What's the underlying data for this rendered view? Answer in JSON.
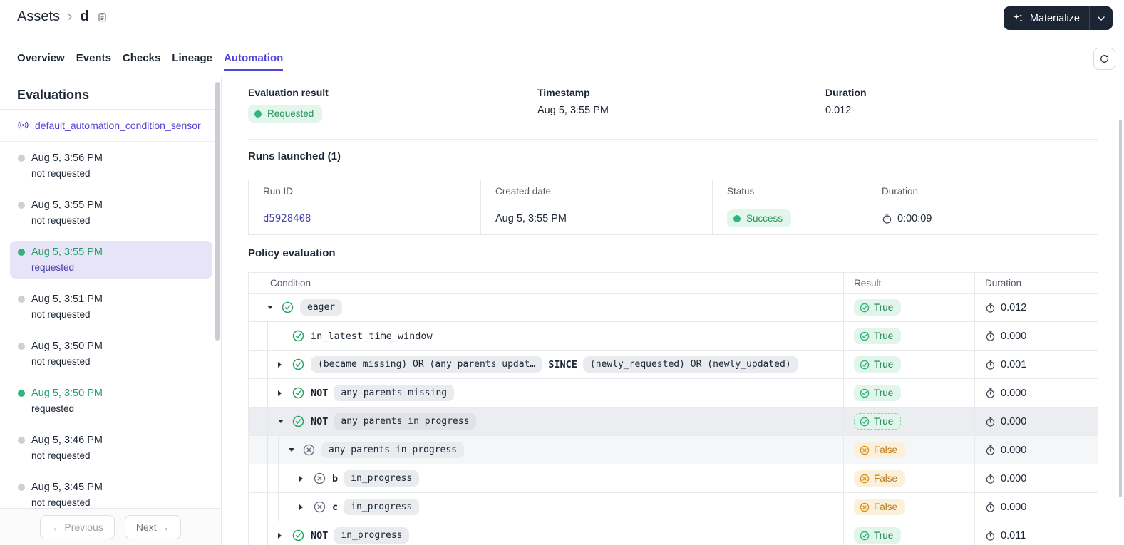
{
  "header": {
    "breadcrumb": {
      "root": "Assets",
      "separator": "›",
      "current": "d"
    },
    "materialize": {
      "label": "Materialize"
    }
  },
  "tabs": [
    {
      "label": "Overview",
      "active": false
    },
    {
      "label": "Events",
      "active": false
    },
    {
      "label": "Checks",
      "active": false
    },
    {
      "label": "Lineage",
      "active": false
    },
    {
      "label": "Automation",
      "active": true
    }
  ],
  "sidebar": {
    "title": "Evaluations",
    "sensor_name": "default_automation_condition_sensor",
    "evaluations": [
      {
        "time": "Aug 5, 3:56 PM",
        "status": "not requested",
        "requested": false,
        "selected": false
      },
      {
        "time": "Aug 5, 3:55 PM",
        "status": "not requested",
        "requested": false,
        "selected": false
      },
      {
        "time": "Aug 5, 3:55 PM",
        "status": "requested",
        "requested": true,
        "selected": true
      },
      {
        "time": "Aug 5, 3:51 PM",
        "status": "not requested",
        "requested": false,
        "selected": false
      },
      {
        "time": "Aug 5, 3:50 PM",
        "status": "not requested",
        "requested": false,
        "selected": false
      },
      {
        "time": "Aug 5, 3:50 PM",
        "status": "requested",
        "requested": true,
        "selected": false
      },
      {
        "time": "Aug 5, 3:46 PM",
        "status": "not requested",
        "requested": false,
        "selected": false
      },
      {
        "time": "Aug 5, 3:45 PM",
        "status": "not requested",
        "requested": false,
        "selected": false
      }
    ],
    "pagination": {
      "prev_arrow": "←",
      "previous": "Previous",
      "next": "Next",
      "next_arrow": "→"
    }
  },
  "summary": {
    "evaluation_result": {
      "label": "Evaluation result",
      "value": "Requested"
    },
    "timestamp": {
      "label": "Timestamp",
      "value": "Aug 5, 3:55 PM"
    },
    "duration": {
      "label": "Duration",
      "value": "0.012"
    }
  },
  "runs": {
    "title": "Runs launched (1)",
    "columns": [
      "Run ID",
      "Created date",
      "Status",
      "Duration"
    ],
    "rows": [
      {
        "run_id": "d5928408",
        "created": "Aug 5, 3:55 PM",
        "status": "Success",
        "duration": "0:00:09"
      }
    ]
  },
  "policy": {
    "title": "Policy evaluation",
    "columns": [
      "Condition",
      "Result",
      "Duration"
    ],
    "rows": [
      {
        "indent": 0,
        "caret": "down",
        "icon": "check",
        "parts": [
          {
            "t": "tag",
            "text": "eager"
          }
        ],
        "result": "True",
        "duration": "0.012",
        "bg": "",
        "result_selected": false
      },
      {
        "indent": 1,
        "caret": "",
        "icon": "check",
        "parts": [
          {
            "t": "plain",
            "text": "in_latest_time_window"
          }
        ],
        "result": "True",
        "duration": "0.000",
        "bg": "",
        "result_selected": false
      },
      {
        "indent": 1,
        "caret": "right",
        "icon": "check",
        "parts": [
          {
            "t": "tag",
            "text": "(became missing) OR (any parents updat…"
          },
          {
            "t": "bold",
            "text": "SINCE"
          },
          {
            "t": "tag",
            "text": "(newly_requested) OR (newly_updated)"
          }
        ],
        "result": "True",
        "duration": "0.001",
        "bg": "",
        "result_selected": false
      },
      {
        "indent": 1,
        "caret": "right",
        "icon": "check",
        "parts": [
          {
            "t": "bold",
            "text": "NOT"
          },
          {
            "t": "tag",
            "text": "any parents missing"
          }
        ],
        "result": "True",
        "duration": "0.000",
        "bg": "",
        "result_selected": false
      },
      {
        "indent": 1,
        "caret": "down",
        "icon": "check",
        "parts": [
          {
            "t": "bold",
            "text": "NOT"
          },
          {
            "t": "tag",
            "text": "any parents in progress"
          }
        ],
        "result": "True",
        "duration": "0.000",
        "bg": "dark",
        "result_selected": true
      },
      {
        "indent": 2,
        "caret": "down",
        "icon": "x",
        "parts": [
          {
            "t": "tag",
            "text": "any parents in progress"
          }
        ],
        "result": "False",
        "duration": "0.000",
        "bg": "light",
        "result_selected": false
      },
      {
        "indent": 3,
        "caret": "right",
        "icon": "x",
        "parts": [
          {
            "t": "bold",
            "text": "b"
          },
          {
            "t": "tag",
            "text": "in_progress"
          }
        ],
        "result": "False",
        "duration": "0.000",
        "bg": "",
        "result_selected": false
      },
      {
        "indent": 3,
        "caret": "right",
        "icon": "x",
        "parts": [
          {
            "t": "bold",
            "text": "c"
          },
          {
            "t": "tag",
            "text": "in_progress"
          }
        ],
        "result": "False",
        "duration": "0.000",
        "bg": "",
        "result_selected": false
      },
      {
        "indent": 1,
        "caret": "right",
        "icon": "check",
        "parts": [
          {
            "t": "bold",
            "text": "NOT"
          },
          {
            "t": "tag",
            "text": "in_progress"
          }
        ],
        "result": "True",
        "duration": "0.011",
        "bg": "",
        "result_selected": false
      }
    ]
  },
  "colors": {
    "accent_purple": "#4F43DD",
    "green_dot": "#2FB67C",
    "green_badge_bg": "#E2F6EC",
    "green_badge_text": "#208457",
    "orange_badge_bg": "#FBF0DC",
    "orange_badge_text": "#BD7A15",
    "selected_item_bg": "#E7E4F8",
    "materialize_button_bg": "#1B2534",
    "row_highlight_dark": "#EBEDF0",
    "row_highlight_light": "#F5F6F8"
  }
}
